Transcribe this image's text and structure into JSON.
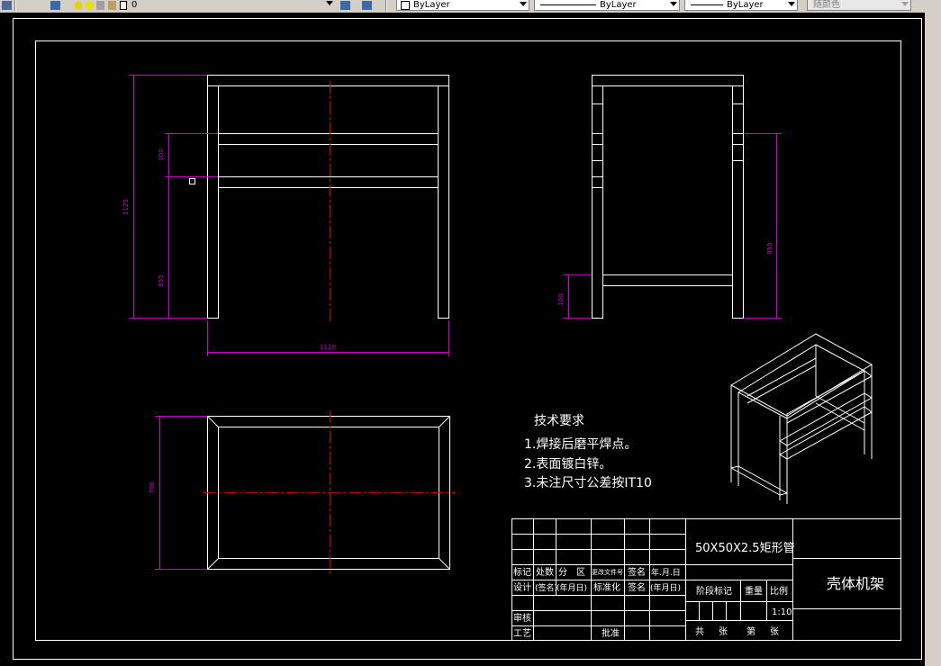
{
  "toolbar": {
    "layer_name": "0",
    "color_label": "ByLayer",
    "linetype_label": "ByLayer",
    "lineweight_label": "ByLayer",
    "plotstyle_label": "随颜色"
  },
  "dims": {
    "front_height": "1125",
    "front_upper": "300",
    "front_lower": "855",
    "front_width": "1120",
    "side_lower": "100",
    "side_right": "855",
    "top_depth": "700"
  },
  "notes": {
    "title": "技术要求",
    "items": [
      "1.焊接后磨平焊点。",
      "2.表面镀白锌。",
      "3.未注尺寸公差按IT10"
    ]
  },
  "title_block": {
    "material": "50X50X2.5矩形管",
    "part_name": "壳体机架",
    "scale": "1:10",
    "row_labels": [
      "标记",
      "处数",
      "分　区",
      "更改文件号",
      "签名",
      "年.月.日"
    ],
    "row2_labels": [
      "设计",
      "(签名)",
      "(年月日)",
      "标准化",
      "签名",
      "(年月日)"
    ],
    "approve_labels": [
      "审核",
      "工艺",
      "批准"
    ],
    "stage_label": "阶段标记",
    "weight_label": "重量",
    "scale_label": "比例",
    "sheet_labels": [
      "共",
      "张",
      "第",
      "张"
    ]
  }
}
